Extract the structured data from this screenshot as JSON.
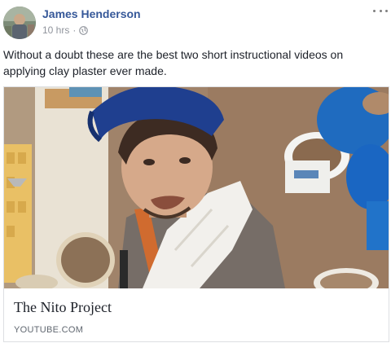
{
  "post": {
    "author": "James Henderson",
    "time": "10 hrs",
    "separator": "·",
    "privacy_icon": "globe-icon",
    "text": "Without a doubt these are the best two short instructional videos on applying clay plaster ever made.",
    "options_icon": "more-options-icon"
  },
  "link_card": {
    "title": "The Nito Project",
    "domain": "YOUTUBE.COM",
    "thumbnail": "video-thumbnail"
  },
  "colors": {
    "author_link": "#365899",
    "meta_text": "#90949c",
    "card_border": "#dddfe2",
    "domain_text": "#606770"
  }
}
